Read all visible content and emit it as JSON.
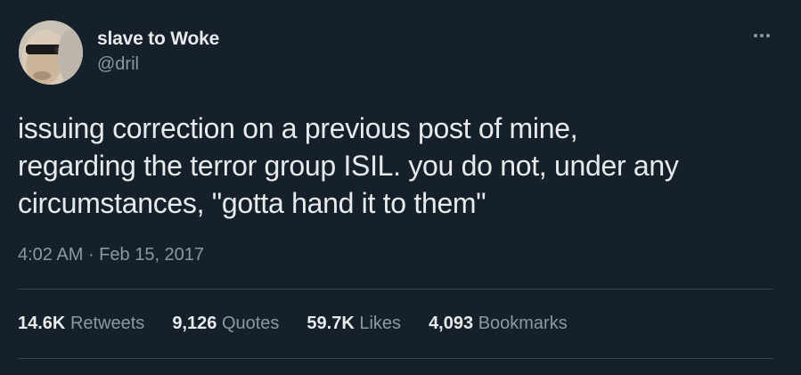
{
  "tweet": {
    "display_name": "slave to Woke",
    "handle": "@dril",
    "text": "issuing correction on a previous post of mine, regarding the terror group ISIL. you do not, under any circumstances, \"gotta hand it to them\"",
    "text_lines": [
      "issuing correction on a previous post of mine,",
      "regarding the terror group ISIL. you do not, under any",
      "circumstances, \"gotta hand it to them\""
    ],
    "time": "4:02 AM",
    "separator": " · ",
    "date": "Feb 15, 2017",
    "more_icon": "more-horizontal-icon"
  },
  "stats": [
    {
      "value": "14.6K",
      "label": "Retweets"
    },
    {
      "value": "9,126",
      "label": "Quotes"
    },
    {
      "value": "59.7K",
      "label": "Likes"
    },
    {
      "value": "4,093",
      "label": "Bookmarks"
    }
  ],
  "colors": {
    "background": "#15202b",
    "primary_text": "#e7e9ea",
    "secondary_text": "#8b98a5",
    "divider": "#38444d"
  }
}
